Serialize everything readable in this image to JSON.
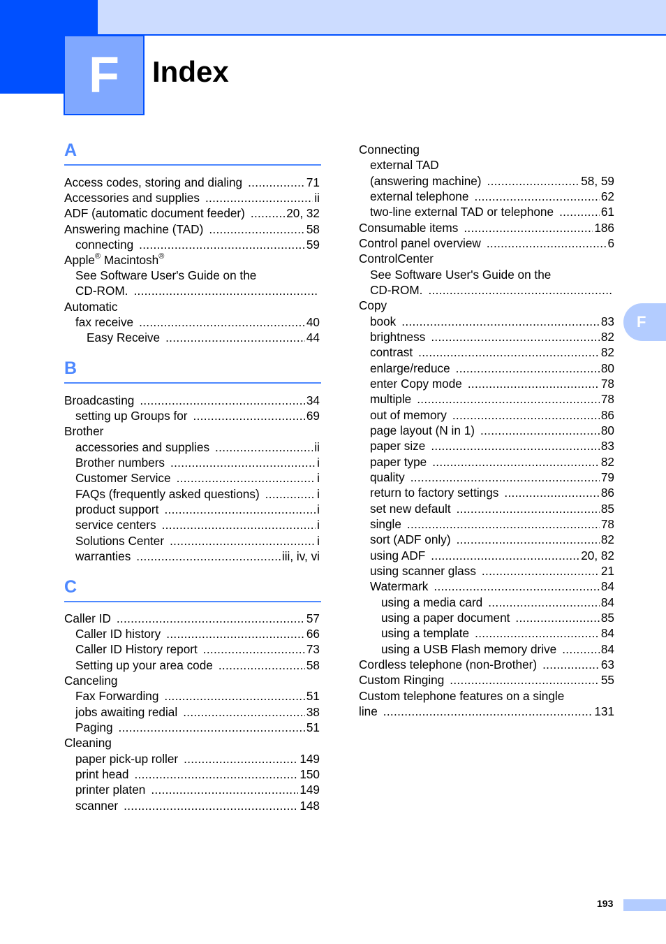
{
  "chapter": {
    "letter": "F",
    "title": "Index",
    "side_tab": "F"
  },
  "page_number": "193",
  "colors": {
    "brand_dark": "#0050ff",
    "brand_mid": "#80a8ff",
    "brand_light": "#ccdcff",
    "letter_heading": "#4d88ff",
    "side_tab": "#b3ccff"
  },
  "sections": {
    "A": {
      "letter": "A"
    },
    "B": {
      "letter": "B"
    },
    "C": {
      "letter": "C"
    }
  },
  "left": [
    {
      "level": 0,
      "term": "Access codes, storing and dialing",
      "page": "71"
    },
    {
      "level": 0,
      "term": "Accessories and supplies",
      "page": "ii"
    },
    {
      "level": 0,
      "term": "ADF (automatic document feeder)",
      "page": "20, 32"
    },
    {
      "level": 0,
      "term": "Answering machine (TAD)",
      "page": "58"
    },
    {
      "level": 1,
      "term": "connecting",
      "page": "59"
    },
    {
      "level": 0,
      "term": "Apple® Macintosh®",
      "page": ""
    },
    {
      "level": 1,
      "term": "See Software User's Guide on the",
      "page": ""
    },
    {
      "level": 1,
      "term": "CD-ROM.",
      "page": ""
    },
    {
      "level": 0,
      "term": "Automatic",
      "page": ""
    },
    {
      "level": 1,
      "term": "fax receive",
      "page": "40"
    },
    {
      "level": 2,
      "term": "Easy Receive",
      "page": "44"
    },
    {
      "level": 0,
      "term": "Broadcasting",
      "page": "34"
    },
    {
      "level": 1,
      "term": "setting up Groups for",
      "page": "69"
    },
    {
      "level": 0,
      "term": "Brother",
      "page": ""
    },
    {
      "level": 1,
      "term": "accessories and supplies",
      "page": "ii"
    },
    {
      "level": 1,
      "term": "Brother numbers",
      "page": "i"
    },
    {
      "level": 1,
      "term": "Customer Service",
      "page": "i"
    },
    {
      "level": 1,
      "term": "FAQs (frequently asked questions)",
      "page": "i"
    },
    {
      "level": 1,
      "term": "product support",
      "page": "i"
    },
    {
      "level": 1,
      "term": "service centers",
      "page": "i"
    },
    {
      "level": 1,
      "term": "Solutions Center",
      "page": "i"
    },
    {
      "level": 1,
      "term": "warranties",
      "page": "iii, iv, vi"
    },
    {
      "level": 0,
      "term": "Caller ID",
      "page": "57"
    },
    {
      "level": 1,
      "term": "Caller ID history",
      "page": "66"
    },
    {
      "level": 1,
      "term": "Caller ID History report",
      "page": "73"
    },
    {
      "level": 1,
      "term": "Setting up your area code",
      "page": "58"
    },
    {
      "level": 0,
      "term": "Canceling",
      "page": ""
    },
    {
      "level": 1,
      "term": "Fax Forwarding",
      "page": "51"
    },
    {
      "level": 1,
      "term": "jobs awaiting redial",
      "page": "38"
    },
    {
      "level": 1,
      "term": "Paging",
      "page": "51"
    },
    {
      "level": 0,
      "term": "Cleaning",
      "page": ""
    },
    {
      "level": 1,
      "term": "paper pick-up roller",
      "page": "149"
    },
    {
      "level": 1,
      "term": "print head",
      "page": "150"
    },
    {
      "level": 1,
      "term": "printer platen",
      "page": "149"
    },
    {
      "level": 1,
      "term": "scanner",
      "page": "148"
    }
  ],
  "right": [
    {
      "level": 0,
      "term": "Connecting",
      "page": ""
    },
    {
      "level": 1,
      "term": "external TAD",
      "page": ""
    },
    {
      "level": 1,
      "term": "(answering machine)",
      "page": "58, 59"
    },
    {
      "level": 1,
      "term": "external telephone",
      "page": "62"
    },
    {
      "level": 1,
      "term": "two-line external TAD or telephone",
      "page": "61"
    },
    {
      "level": 0,
      "term": "Consumable items",
      "page": "186"
    },
    {
      "level": 0,
      "term": "Control panel overview",
      "page": "6"
    },
    {
      "level": 0,
      "term": "ControlCenter",
      "page": ""
    },
    {
      "level": 1,
      "term": "See Software User's Guide on the",
      "page": ""
    },
    {
      "level": 1,
      "term": "CD-ROM.",
      "page": ""
    },
    {
      "level": 0,
      "term": "Copy",
      "page": ""
    },
    {
      "level": 1,
      "term": "book",
      "page": "83"
    },
    {
      "level": 1,
      "term": "brightness",
      "page": "82"
    },
    {
      "level": 1,
      "term": "contrast",
      "page": "82"
    },
    {
      "level": 1,
      "term": "enlarge/reduce",
      "page": "80"
    },
    {
      "level": 1,
      "term": "enter Copy mode",
      "page": "78"
    },
    {
      "level": 1,
      "term": "multiple",
      "page": "78"
    },
    {
      "level": 1,
      "term": "out of memory",
      "page": "86"
    },
    {
      "level": 1,
      "term": "page layout (N in 1)",
      "page": "80"
    },
    {
      "level": 1,
      "term": "paper size",
      "page": "83"
    },
    {
      "level": 1,
      "term": "paper type",
      "page": "82"
    },
    {
      "level": 1,
      "term": "quality",
      "page": "79"
    },
    {
      "level": 1,
      "term": "return to factory settings",
      "page": "86"
    },
    {
      "level": 1,
      "term": "set new default",
      "page": "85"
    },
    {
      "level": 1,
      "term": "single",
      "page": "78"
    },
    {
      "level": 1,
      "term": "sort (ADF only)",
      "page": "82"
    },
    {
      "level": 1,
      "term": "using ADF",
      "page": "20, 82"
    },
    {
      "level": 1,
      "term": "using scanner glass",
      "page": "21"
    },
    {
      "level": 1,
      "term": "Watermark",
      "page": "84"
    },
    {
      "level": 2,
      "term": "using a media card",
      "page": "84"
    },
    {
      "level": 2,
      "term": "using a paper document",
      "page": "85"
    },
    {
      "level": 2,
      "term": "using a template",
      "page": "84"
    },
    {
      "level": 2,
      "term": "using a USB Flash memory drive",
      "page": "84"
    },
    {
      "level": 0,
      "term": "Cordless telephone (non-Brother)",
      "page": "63"
    },
    {
      "level": 0,
      "term": "Custom Ringing",
      "page": "55"
    },
    {
      "level": 0,
      "term": "Custom telephone features on a single",
      "page": ""
    },
    {
      "level": 0,
      "term": "line",
      "page": "131"
    }
  ]
}
